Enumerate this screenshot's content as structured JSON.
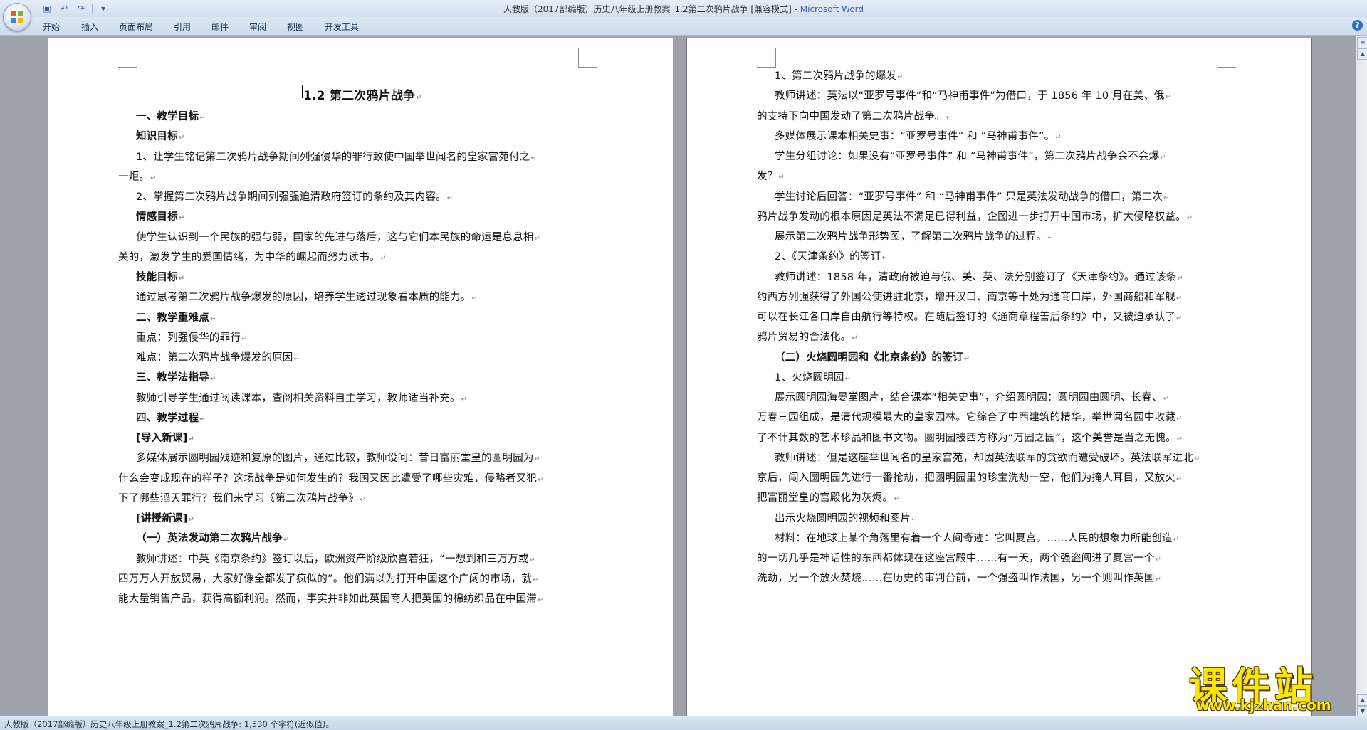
{
  "window": {
    "title_doc": "人教版（2017部编版）历史八年级上册教案_1.2第二次鸦片战争 [兼容模式]",
    "title_sep": " - ",
    "title_app": "Microsoft Word"
  },
  "ribbon": {
    "tabs": [
      "开始",
      "插入",
      "页面布局",
      "引用",
      "邮件",
      "审阅",
      "视图",
      "开发工具"
    ],
    "help": "?"
  },
  "quick_access": {
    "icons": [
      "save-icon",
      "undo-icon",
      "redo-icon",
      "customize-icon"
    ],
    "glyphs": [
      "▣",
      "↶",
      "↷",
      "▾"
    ]
  },
  "page1": {
    "title": "1.2  第二次鸦片战争",
    "lines": [
      {
        "text": "一、教学目标",
        "bold": true
      },
      {
        "text": "知识目标",
        "bold": true
      },
      {
        "text": "1、让学生铭记第二次鸦片战争期间列强侵华的罪行致使中国举世闻名的皇家宫苑付之",
        "bold": false
      },
      {
        "text": "一炬。",
        "bold": false
      },
      {
        "text": "2、掌握第二次鸦片战争期间列强强迫清政府签订的条约及其内容。",
        "bold": false
      },
      {
        "text": "情感目标",
        "bold": true
      },
      {
        "text": "使学生认识到一个民族的强与弱，国家的先进与落后，这与它们本民族的命运是息息相",
        "bold": false
      },
      {
        "text": "关的，激发学生的爱国情绪，为中华的崛起而努力读书。",
        "bold": false
      },
      {
        "text": "技能目标",
        "bold": true
      },
      {
        "text": "通过思考第二次鸦片战争爆发的原因，培养学生透过现象看本质的能力。",
        "bold": false
      },
      {
        "text": "二、教学重难点",
        "bold": true
      },
      {
        "text": "重点：列强侵华的罪行",
        "bold": false
      },
      {
        "text": "难点：第二次鸦片战争爆发的原因",
        "bold": false
      },
      {
        "text": "三、教学法指导",
        "bold": true
      },
      {
        "text": "教师引导学生通过阅读课本，查阅相关资料自主学习，教师适当补充。",
        "bold": false
      },
      {
        "text": "四、教学过程",
        "bold": true
      },
      {
        "text": "[导入新课]",
        "bold": true
      },
      {
        "text": "多媒体展示圆明园残迹和复原的图片，通过比较，教师设问：昔日富丽堂皇的圆明园为",
        "bold": false
      },
      {
        "text": "什么会变成现在的样子？这场战争是如何发生的？我国又因此遭受了哪些灾难，侵略者又犯",
        "bold": false
      },
      {
        "text": "下了哪些滔天罪行？我们来学习《第二次鸦片战争》",
        "bold": false
      },
      {
        "text": "[讲授新课]",
        "bold": true
      },
      {
        "text": "（一）英法发动第二次鸦片战争",
        "bold": true
      },
      {
        "text": "教师讲述：中英《南京条约》签订以后，欧洲资产阶级欣喜若狂，“一想到和三万万或",
        "bold": false
      },
      {
        "text": "四万万人开放贸易，大家好像全都发了疯似的”。他们满以为打开中国这个广阔的市场，就",
        "bold": false
      },
      {
        "text": "能大量销售产品，获得高额利润。然而，事实并非如此英国商人把英国的棉纺织品在中国滞",
        "bold": false
      }
    ]
  },
  "page2": {
    "lines": [
      {
        "text": "1、第二次鸦片战争的爆发",
        "bold": false
      },
      {
        "text": "教师讲述：英法以“亚罗号事件”和“马神甫事件”为借口，于 1856 年 10 月在美、俄",
        "bold": false
      },
      {
        "text": "的支持下向中国发动了第二次鸦片战争。",
        "bold": false
      },
      {
        "text": "多媒体展示课本相关史事：“亚罗号事件” 和 “马神甫事件”。",
        "bold": false
      },
      {
        "text": "学生分组讨论：如果没有“亚罗号事件” 和 “马神甫事件”，第二次鸦片战争会不会爆",
        "bold": false
      },
      {
        "text": "发？",
        "bold": false
      },
      {
        "text": "学生讨论后回答：“亚罗号事件” 和 “马神甫事件” 只是英法发动战争的借口，第二次",
        "bold": false
      },
      {
        "text": "鸦片战争发动的根本原因是英法不满足已得利益，企图进一步打开中国市场，扩大侵略权益。",
        "bold": false
      },
      {
        "text": "展示第二次鸦片战争形势图，了解第二次鸦片战争的过程。",
        "bold": false
      },
      {
        "text": "2、《天津条约》的签订",
        "bold": false
      },
      {
        "text": "教师讲述：1858 年，清政府被迫与俄、美、英、法分别签订了《天津条约》。通过该条",
        "bold": false
      },
      {
        "text": "约西方列强获得了外国公使进驻北京，增开汉口、南京等十处为通商口岸，外国商船和军舰",
        "bold": false
      },
      {
        "text": "可以在长江各口岸自由航行等特权。在随后签订的《通商章程善后条约》中，又被迫承认了",
        "bold": false
      },
      {
        "text": "鸦片贸易的合法化。",
        "bold": false
      },
      {
        "text": "（二）火烧圆明园和《北京条约》的签订",
        "bold": true
      },
      {
        "text": "1、火烧圆明园",
        "bold": false
      },
      {
        "text": "展示圆明园海晏堂图片，结合课本“相关史事”，介绍圆明园：圆明园由圆明、长春、",
        "bold": false
      },
      {
        "text": "万春三园组成，是清代规模最大的皇家园林。它综合了中西建筑的精华，举世闻名园中收藏",
        "bold": false
      },
      {
        "text": "了不计其数的艺术珍品和图书文物。圆明园被西方称为“万园之园”，这个美誉是当之无愧。",
        "bold": false
      },
      {
        "text": "教师讲述：但是这座举世闻名的皇家宫苑，却因英法联军的贪欲而遭受破坏。英法联军进北",
        "bold": false
      },
      {
        "text": "京后，闯入圆明园先进行一番抢劫，把圆明园里的珍宝洗劫一空，他们为掩人耳目，又放火",
        "bold": false
      },
      {
        "text": "把富丽堂皇的宫殿化为灰烬。",
        "bold": false
      },
      {
        "text": "出示火烧圆明园的视频和图片",
        "bold": false
      },
      {
        "text": "材料：在地球上某个角落里有着一个人间奇迹：它叫夏宫。……人民的想象力所能创造",
        "bold": false
      },
      {
        "text": "的一切几乎是神话性的东西都体现在这座宫殿中……有一天，两个强盗闯进了夏宫一个",
        "bold": false
      },
      {
        "text": "洗劫，另一个放火焚烧……在历史的审判台前，一个强盗叫作法国，另一个则叫作英国",
        "bold": false
      }
    ]
  },
  "status": {
    "text": "人教版（2017部编版）历史八年级上册教案_1.2第二次鸦片战争: 1,530 个字符(近似值)。"
  },
  "watermark": {
    "brand": "课件站",
    "url": "www.kjzhan.com"
  }
}
